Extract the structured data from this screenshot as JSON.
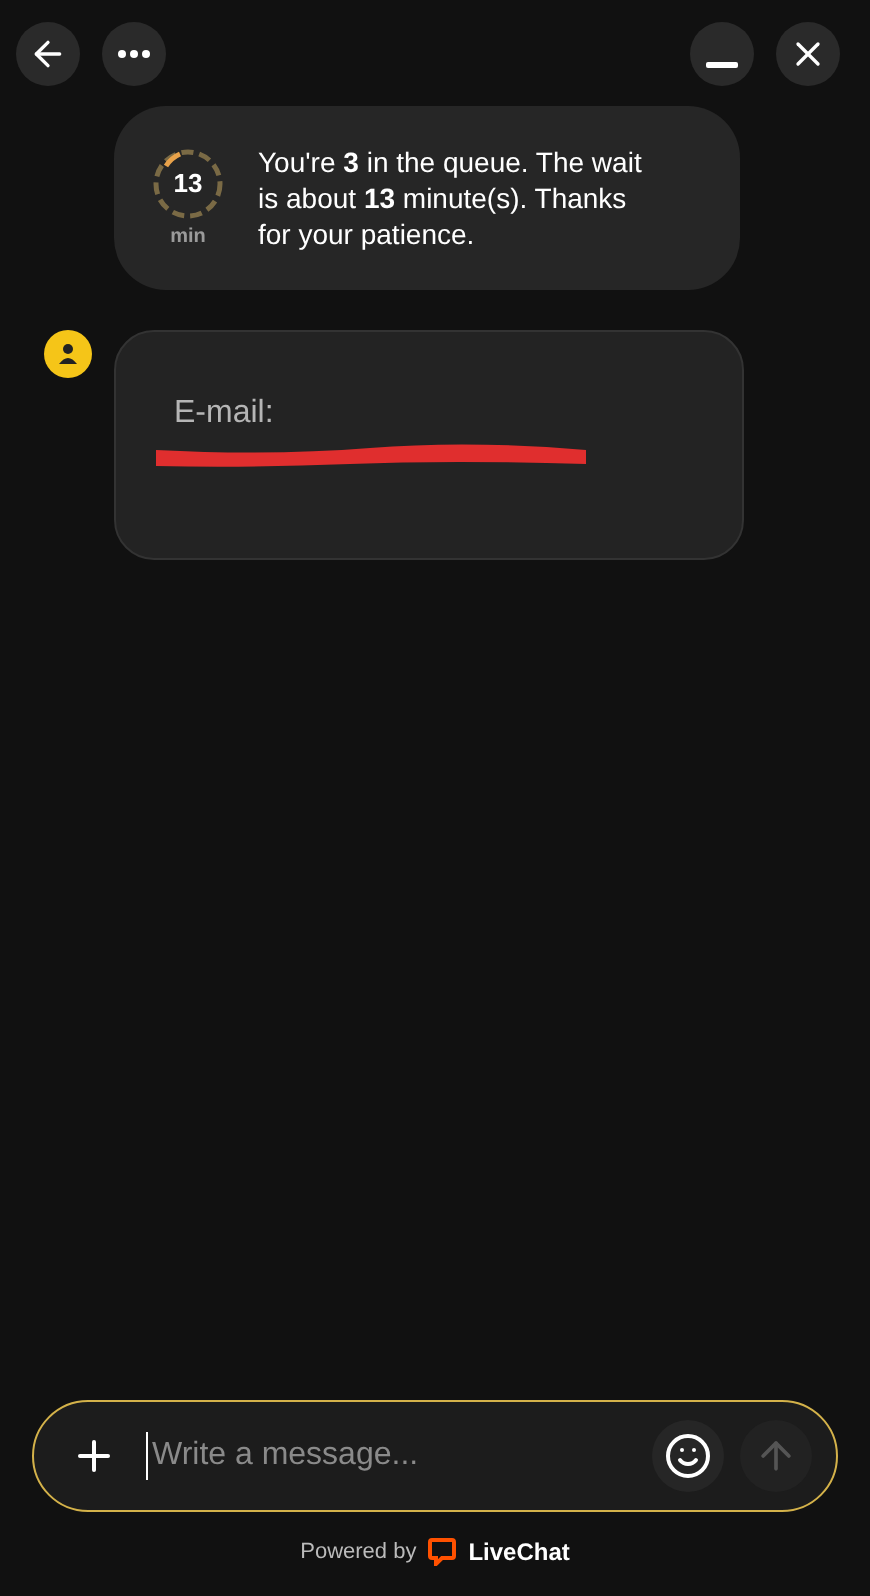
{
  "queue": {
    "minutes": "13",
    "unit": "min",
    "message": "You're **3** in the queue. The wait is about **13** minute(s). Thanks for your patience."
  },
  "messages": [
    {
      "kind": "form",
      "label": "E-mail:",
      "redacted": true
    }
  ],
  "composer": {
    "placeholder": "Write a message..."
  },
  "footer": {
    "powered_by": "Powered by",
    "brand": "LiveChat"
  }
}
